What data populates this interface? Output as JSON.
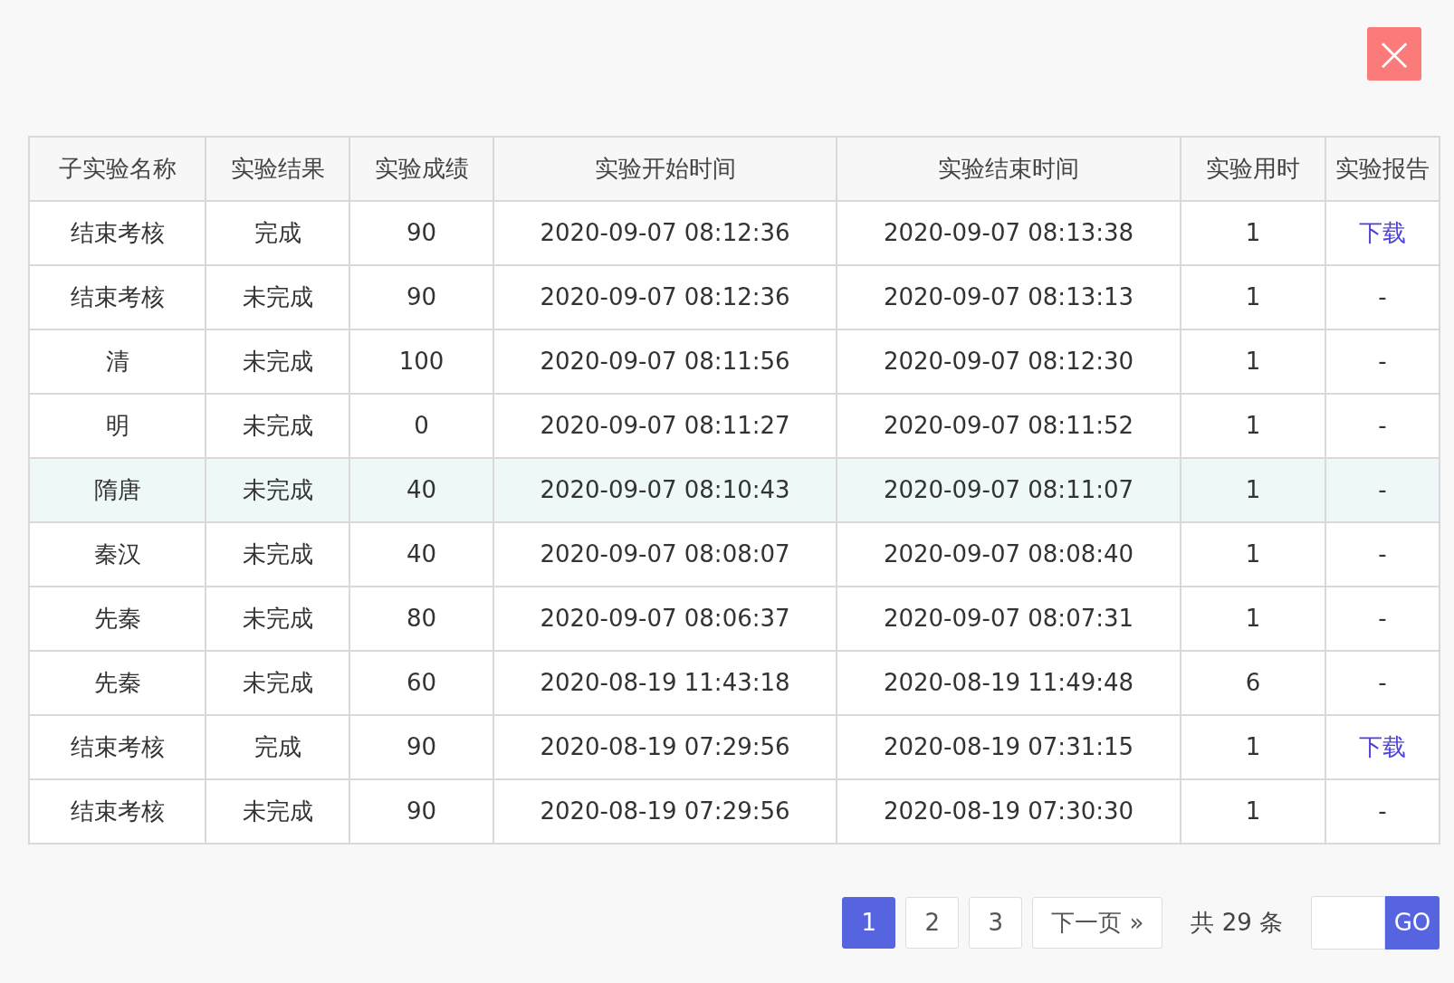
{
  "close_button": {
    "label": "×"
  },
  "table": {
    "columns": [
      "子实验名称",
      "实验结果",
      "实验成绩",
      "实验开始时间",
      "实验结束时间",
      "实验用时",
      "实验报告"
    ],
    "rows": [
      {
        "highlighted": false,
        "cells": [
          "结束考核",
          "完成",
          "90",
          "2020-09-07 08:12:36",
          "2020-09-07 08:13:38",
          "1"
        ],
        "report": {
          "kind": "link",
          "text": "下载"
        }
      },
      {
        "highlighted": false,
        "cells": [
          "结束考核",
          "未完成",
          "90",
          "2020-09-07 08:12:36",
          "2020-09-07 08:13:13",
          "1"
        ],
        "report": {
          "kind": "text",
          "text": "-"
        }
      },
      {
        "highlighted": false,
        "cells": [
          "清",
          "未完成",
          "100",
          "2020-09-07 08:11:56",
          "2020-09-07 08:12:30",
          "1"
        ],
        "report": {
          "kind": "text",
          "text": "-"
        }
      },
      {
        "highlighted": false,
        "cells": [
          "明",
          "未完成",
          "0",
          "2020-09-07 08:11:27",
          "2020-09-07 08:11:52",
          "1"
        ],
        "report": {
          "kind": "text",
          "text": "-"
        }
      },
      {
        "highlighted": true,
        "cells": [
          "隋唐",
          "未完成",
          "40",
          "2020-09-07 08:10:43",
          "2020-09-07 08:11:07",
          "1"
        ],
        "report": {
          "kind": "text",
          "text": "-"
        }
      },
      {
        "highlighted": false,
        "cells": [
          "秦汉",
          "未完成",
          "40",
          "2020-09-07 08:08:07",
          "2020-09-07 08:08:40",
          "1"
        ],
        "report": {
          "kind": "text",
          "text": "-"
        }
      },
      {
        "highlighted": false,
        "cells": [
          "先秦",
          "未完成",
          "80",
          "2020-09-07 08:06:37",
          "2020-09-07 08:07:31",
          "1"
        ],
        "report": {
          "kind": "text",
          "text": "-"
        }
      },
      {
        "highlighted": false,
        "cells": [
          "先秦",
          "未完成",
          "60",
          "2020-08-19 11:43:18",
          "2020-08-19 11:49:48",
          "6"
        ],
        "report": {
          "kind": "text",
          "text": "-"
        }
      },
      {
        "highlighted": false,
        "cells": [
          "结束考核",
          "完成",
          "90",
          "2020-08-19 07:29:56",
          "2020-08-19 07:31:15",
          "1"
        ],
        "report": {
          "kind": "link",
          "text": "下载"
        }
      },
      {
        "highlighted": false,
        "cells": [
          "结束考核",
          "未完成",
          "90",
          "2020-08-19 07:29:56",
          "2020-08-19 07:30:30",
          "1"
        ],
        "report": {
          "kind": "text",
          "text": "-"
        }
      }
    ]
  },
  "pagination": {
    "pages": [
      {
        "label": "1",
        "selected": true
      },
      {
        "label": "2",
        "selected": false
      },
      {
        "label": "3",
        "selected": false
      }
    ],
    "next": "下一页 »",
    "total": "共 29 条",
    "go": "GO"
  }
}
